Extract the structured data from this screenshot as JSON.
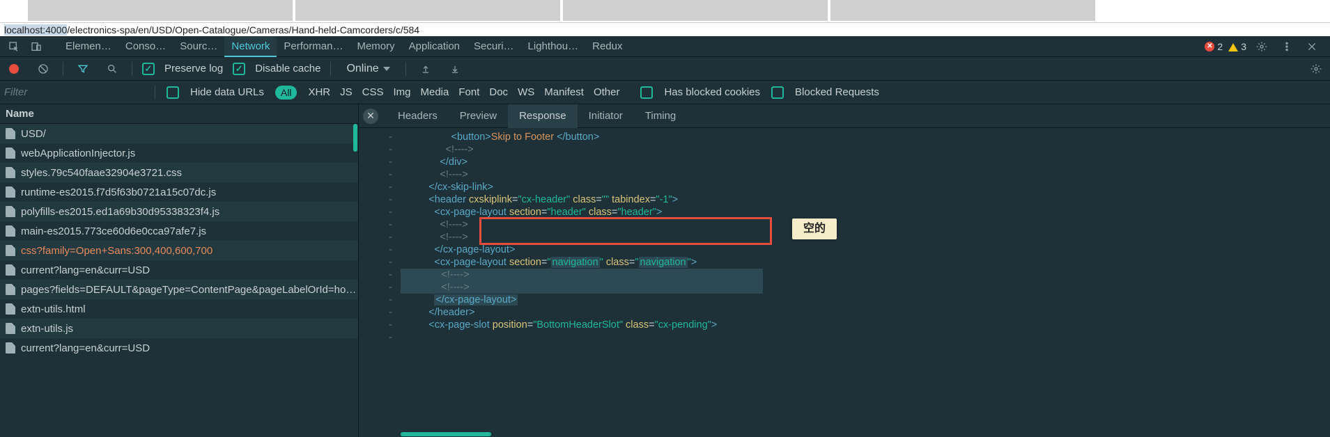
{
  "url_prefix": "localhost:4000",
  "url_path": "/electronics-spa/en/USD/Open-Catalogue/Cameras/Hand-held-Camcorders/c/584",
  "main_tabs": {
    "elements": "Elemen…",
    "console": "Conso…",
    "sources": "Sourc…",
    "network": "Network",
    "performance": "Performan…",
    "memory": "Memory",
    "application": "Application",
    "security": "Securi…",
    "lighthouse": "Lighthou…",
    "redux": "Redux"
  },
  "errors_count": "2",
  "warnings_count": "3",
  "toolbar": {
    "preserve_log": "Preserve log",
    "disable_cache": "Disable cache",
    "throttling": "Online"
  },
  "filter_placeholder": "Filter",
  "hide_data_urls": "Hide data URLs",
  "type_all": "All",
  "types": [
    "XHR",
    "JS",
    "CSS",
    "Img",
    "Media",
    "Font",
    "Doc",
    "WS",
    "Manifest",
    "Other"
  ],
  "has_blocked_cookies": "Has blocked cookies",
  "blocked_requests": "Blocked Requests",
  "name_header": "Name",
  "requests": [
    {
      "name": "USD/",
      "hl": false
    },
    {
      "name": "webApplicationInjector.js",
      "hl": false
    },
    {
      "name": "styles.79c540faae32904e3721.css",
      "hl": false
    },
    {
      "name": "runtime-es2015.f7d5f63b0721a15c07dc.js",
      "hl": false
    },
    {
      "name": "polyfills-es2015.ed1a69b30d95338323f4.js",
      "hl": false
    },
    {
      "name": "main-es2015.773ce60d6e0cca97afe7.js",
      "hl": false
    },
    {
      "name": "css?family=Open+Sans:300,400,600,700",
      "hl": true
    },
    {
      "name": "current?lang=en&curr=USD",
      "hl": false
    },
    {
      "name": "pages?fields=DEFAULT&pageType=ContentPage&pageLabelOrId=ho…",
      "hl": false
    },
    {
      "name": "extn-utils.html",
      "hl": false
    },
    {
      "name": "extn-utils.js",
      "hl": false
    },
    {
      "name": "current?lang=en&curr=USD",
      "hl": false
    }
  ],
  "detail_tabs": {
    "headers": "Headers",
    "preview": "Preview",
    "response": "Response",
    "initiator": "Initiator",
    "timing": "Timing"
  },
  "tooltip_text": "空的",
  "code_lines": [
    {
      "g": "-",
      "indent": 18,
      "parts": [
        {
          "t": "<button>",
          "c": "tag"
        },
        {
          "t": "Skip to Footer ",
          "c": "btntxt"
        },
        {
          "t": "</button>",
          "c": "tag"
        }
      ]
    },
    {
      "g": "-",
      "indent": 16,
      "parts": [
        {
          "t": "<!---->",
          "c": "cmt"
        }
      ]
    },
    {
      "g": "-",
      "indent": 14,
      "parts": [
        {
          "t": "</",
          "c": "tag"
        },
        {
          "t": "div",
          "c": "tag"
        },
        {
          "t": ">",
          "c": "tag"
        }
      ]
    },
    {
      "g": "-",
      "indent": 14,
      "parts": [
        {
          "t": "<!---->",
          "c": "cmt"
        }
      ]
    },
    {
      "g": "-",
      "indent": 10,
      "parts": [
        {
          "t": "</",
          "c": "tag"
        },
        {
          "t": "cx-skip-link",
          "c": "tag"
        },
        {
          "t": ">",
          "c": "tag"
        }
      ]
    },
    {
      "g": "-",
      "indent": 10,
      "parts": [
        {
          "t": "<",
          "c": "tag"
        },
        {
          "t": "header",
          "c": "tag"
        },
        {
          "t": " ",
          "c": ""
        },
        {
          "t": "cxskiplink",
          "c": "attrn"
        },
        {
          "t": "=",
          "c": ""
        },
        {
          "t": "\"cx-header\"",
          "c": "attrv"
        },
        {
          "t": " ",
          "c": ""
        },
        {
          "t": "class",
          "c": "attrn"
        },
        {
          "t": "=",
          "c": ""
        },
        {
          "t": "\"\"",
          "c": "attrv"
        },
        {
          "t": " ",
          "c": ""
        },
        {
          "t": "tabindex",
          "c": "attrn"
        },
        {
          "t": "=",
          "c": ""
        },
        {
          "t": "\"-1\"",
          "c": "attrv"
        },
        {
          "t": ">",
          "c": "tag"
        }
      ]
    },
    {
      "g": "-",
      "indent": 12,
      "parts": [
        {
          "t": "<",
          "c": "tag"
        },
        {
          "t": "cx-page-layout",
          "c": "tag"
        },
        {
          "t": " ",
          "c": ""
        },
        {
          "t": "section",
          "c": "attrn"
        },
        {
          "t": "=",
          "c": ""
        },
        {
          "t": "\"header\"",
          "c": "attrv"
        },
        {
          "t": " ",
          "c": ""
        },
        {
          "t": "class",
          "c": "attrn"
        },
        {
          "t": "=",
          "c": ""
        },
        {
          "t": "\"header\"",
          "c": "attrv"
        },
        {
          "t": ">",
          "c": "tag"
        }
      ]
    },
    {
      "g": "-",
      "indent": 14,
      "parts": [
        {
          "t": "<!---->",
          "c": "cmt"
        }
      ]
    },
    {
      "g": "-",
      "indent": 14,
      "parts": [
        {
          "t": "<!---->",
          "c": "cmt"
        }
      ]
    },
    {
      "g": "-",
      "indent": 12,
      "parts": [
        {
          "t": "</",
          "c": "tag"
        },
        {
          "t": "cx-page-layout",
          "c": "tag"
        },
        {
          "t": ">",
          "c": "tag"
        }
      ]
    },
    {
      "g": "-",
      "indent": 12,
      "parts": [
        {
          "t": "<",
          "c": "tag"
        },
        {
          "t": "cx-page-layout",
          "c": "tag"
        },
        {
          "t": " ",
          "c": ""
        },
        {
          "t": "section",
          "c": "attrn"
        },
        {
          "t": "=",
          "c": ""
        },
        {
          "t": "\"",
          "c": "attrv"
        },
        {
          "t": "navigation",
          "c": "attrv",
          "bg": true
        },
        {
          "t": "\"",
          "c": "attrv"
        },
        {
          "t": " ",
          "c": ""
        },
        {
          "t": "class",
          "c": "attrn"
        },
        {
          "t": "=",
          "c": ""
        },
        {
          "t": "\"",
          "c": "attrv"
        },
        {
          "t": "navigation",
          "c": "attrv",
          "bg": true
        },
        {
          "t": "\"",
          "c": "attrv"
        },
        {
          "t": ">",
          "c": "tag"
        }
      ]
    },
    {
      "g": "-",
      "indent": 14,
      "parts": [
        {
          "t": "<!---->",
          "c": "cmt"
        }
      ],
      "linebg": true
    },
    {
      "g": "-",
      "indent": 14,
      "parts": [
        {
          "t": "<!---->",
          "c": "cmt"
        }
      ],
      "linebg": true
    },
    {
      "g": "-",
      "indent": 12,
      "parts": [
        {
          "t": "</cx-page-layout>",
          "c": "tag"
        }
      ],
      "closebg": true
    },
    {
      "g": "-",
      "indent": 10,
      "parts": [
        {
          "t": "</",
          "c": "tag"
        },
        {
          "t": "header",
          "c": "tag"
        },
        {
          "t": ">",
          "c": "tag"
        }
      ]
    },
    {
      "g": "-",
      "indent": 10,
      "parts": [
        {
          "t": "<",
          "c": "tag"
        },
        {
          "t": "cx-page-slot",
          "c": "tag"
        },
        {
          "t": " ",
          "c": ""
        },
        {
          "t": "position",
          "c": "attrn"
        },
        {
          "t": "=",
          "c": ""
        },
        {
          "t": "\"BottomHeaderSlot\"",
          "c": "attrv"
        },
        {
          "t": " ",
          "c": ""
        },
        {
          "t": "class",
          "c": "attrn"
        },
        {
          "t": "=",
          "c": ""
        },
        {
          "t": "\"cx-pending\"",
          "c": "attrv"
        },
        {
          "t": ">",
          "c": "tag"
        }
      ]
    },
    {
      "g": "-",
      "indent": 12,
      "parts": []
    }
  ]
}
